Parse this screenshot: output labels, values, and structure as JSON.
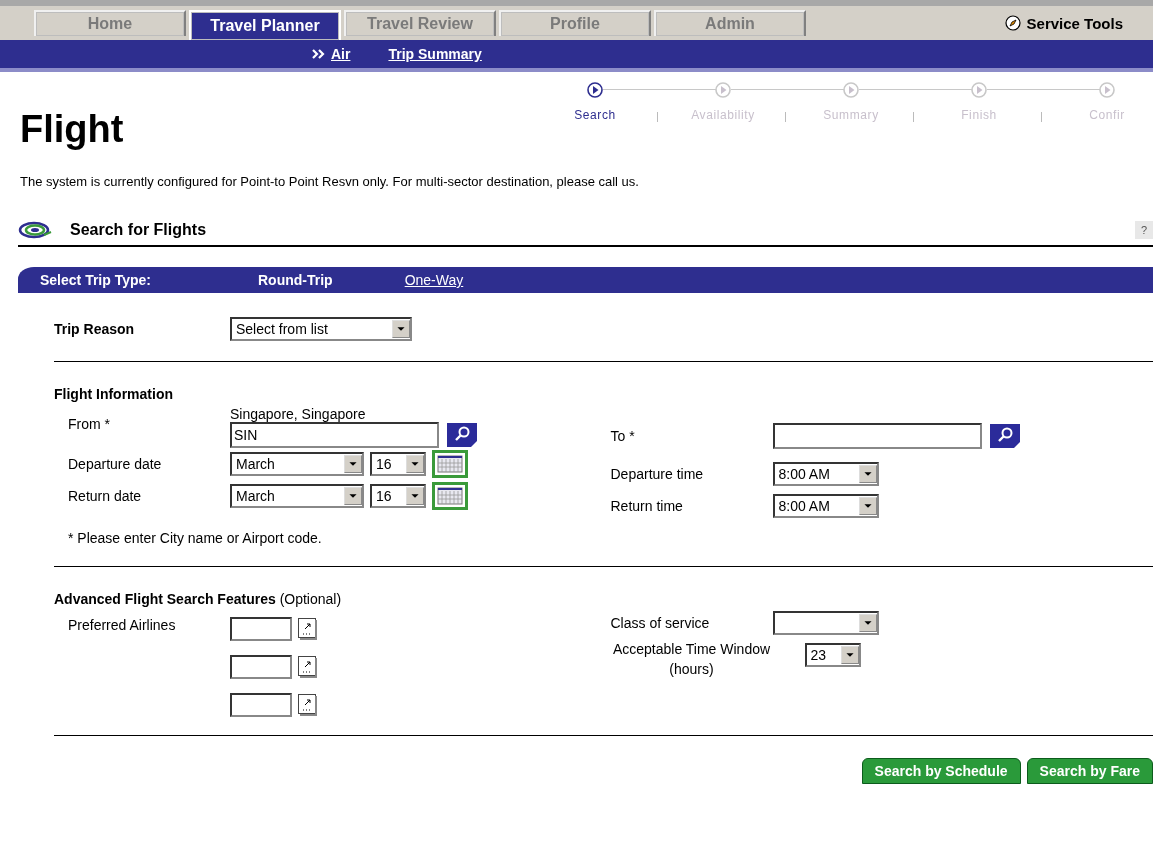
{
  "nav": {
    "tabs": [
      {
        "label": "Home",
        "selected": false
      },
      {
        "label": "Travel Planner",
        "selected": true
      },
      {
        "label": "Travel Review",
        "selected": false
      },
      {
        "label": "Profile",
        "selected": false
      },
      {
        "label": "Admin",
        "selected": false
      }
    ],
    "service_tools": "Service Tools"
  },
  "subnav": {
    "items": [
      {
        "label": "Air",
        "selected": true
      },
      {
        "label": "Trip Summary",
        "selected": false
      }
    ]
  },
  "page_title": "Flight",
  "steps": [
    {
      "label": "Search",
      "selected": true
    },
    {
      "label": "Availability",
      "selected": false
    },
    {
      "label": "Summary",
      "selected": false
    },
    {
      "label": "Finish",
      "selected": false
    },
    {
      "label": "Confir",
      "selected": false
    }
  ],
  "notice": "The system is currently configured for Point-to Point Resvn only. For multi-sector destination, please call us.",
  "section": {
    "title": "Search for Flights",
    "help": "?"
  },
  "trip_type": {
    "label": "Select Trip Type:",
    "options": [
      {
        "label": "Round-Trip",
        "selected": true
      },
      {
        "label": "One-Way",
        "selected": false
      }
    ]
  },
  "trip_reason": {
    "label": "Trip Reason",
    "value": "Select from list"
  },
  "flight_info": {
    "heading": "Flight Information",
    "from": {
      "label": "From *",
      "city": "Singapore, Singapore",
      "value": "SIN"
    },
    "to": {
      "label": "To *"
    },
    "dates": [
      {
        "label": "Departure date",
        "month": "March",
        "day": "16"
      },
      {
        "label": "Return date",
        "month": "March",
        "day": "16"
      }
    ],
    "times": [
      {
        "label": "Departure time",
        "value": "8:00 AM"
      },
      {
        "label": "Return time",
        "value": "8:00 AM"
      }
    ],
    "note": "* Please enter City name or Airport code."
  },
  "advanced": {
    "heading": "Advanced Flight Search Features",
    "optional": "(Optional)",
    "airlines": {
      "label": "Preferred Airlines",
      "fields": [
        {
          "kind": "code"
        },
        {
          "kind": "code"
        },
        {
          "kind": "code"
        }
      ]
    },
    "class_of_service": {
      "label": "Class of service"
    },
    "time_window": {
      "label": "Acceptable Time Window (hours)",
      "value": "23"
    }
  },
  "buttons": [
    "Search by Schedule",
    "Search by Fare"
  ]
}
